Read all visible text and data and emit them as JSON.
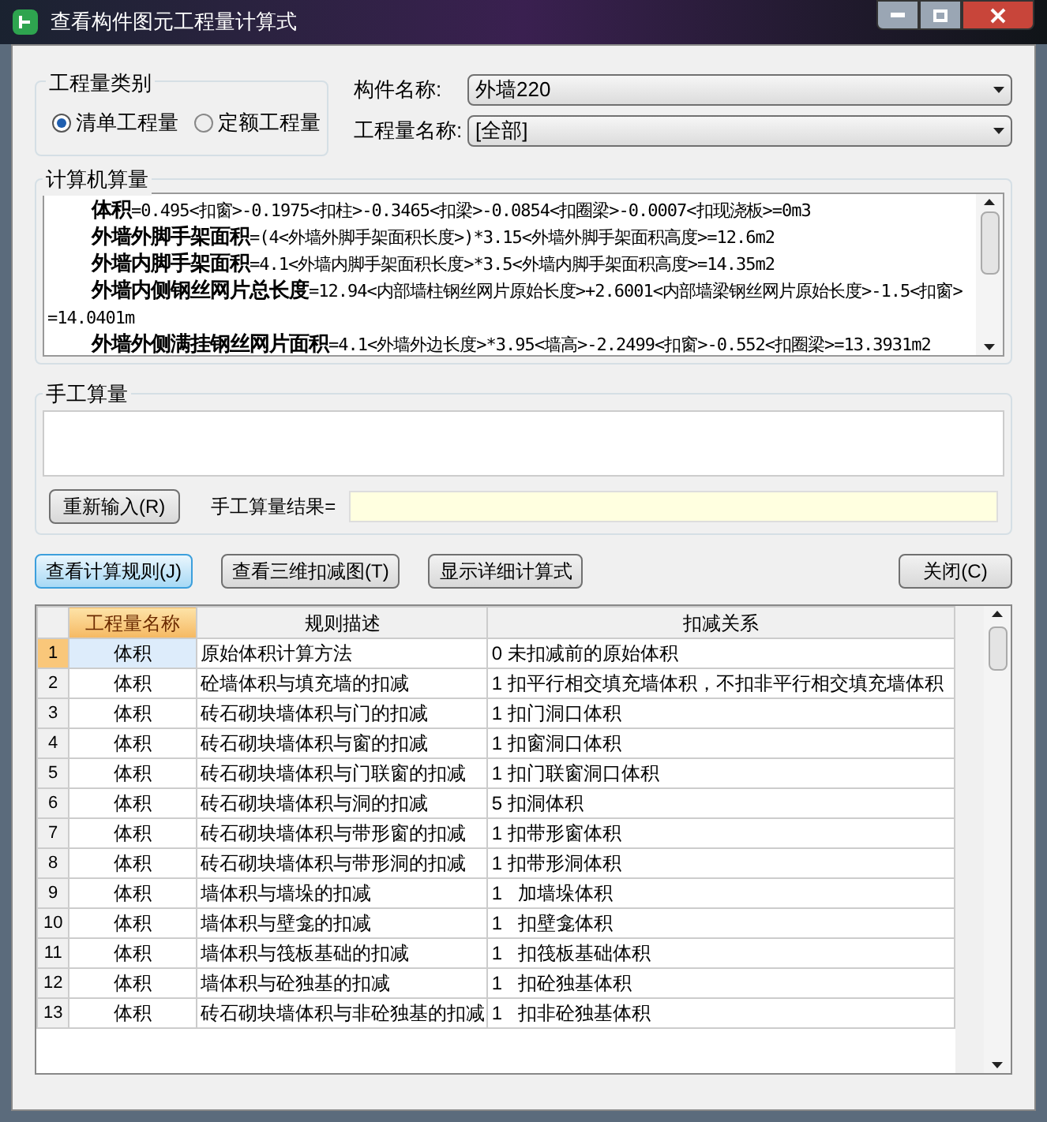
{
  "window": {
    "title": "查看构件图元工程量计算式"
  },
  "quantity_type": {
    "label": "工程量类别",
    "options": [
      {
        "label": "清单工程量",
        "selected": true
      },
      {
        "label": "定额工程量",
        "selected": false
      }
    ]
  },
  "fields": [
    {
      "label": "构件名称:",
      "value": "外墙220"
    },
    {
      "label": "工程量名称:",
      "value": "[全部]"
    }
  ],
  "computer": {
    "label": "计算机算量",
    "lines": [
      "**体积**=0.495<扣窗>-0.1975<扣柱>-0.3465<扣梁>-0.0854<扣圈梁>-0.0007<扣现浇板>=0m3",
      "**外墙外脚手架面积**=(4<外墙外脚手架面积长度>)*3.15<外墙外脚手架面积高度>=12.6m2",
      "**外墙内脚手架面积**=4.1<外墙内脚手架面积长度>*3.5<外墙内脚手架面积高度>=14.35m2",
      "**外墙内侧钢丝网片总长度**=12.94<内部墙柱钢丝网片原始长度>+2.6001<内部墙梁钢丝网片原始长度>-1.5<扣窗>=14.0401m",
      "**外墙外侧满挂钢丝网片面积**=4.1<外墙外边长度>*3.95<墙高>-2.2499<扣窗>-0.552<扣圈梁>=13.3931m2"
    ]
  },
  "manual": {
    "label": "手工算量",
    "reset_button": "重新输入(R)",
    "result_label": "手工算量结果="
  },
  "buttons": [
    {
      "label": "查看计算规则(J)",
      "selected": true
    },
    {
      "label": "查看三维扣减图(T)",
      "selected": false
    },
    {
      "label": "显示详细计算式",
      "selected": false
    },
    {
      "label": "关闭(C)",
      "selected": false
    }
  ],
  "table": {
    "columns": [
      {
        "label": "工程量名称",
        "selected": true
      },
      {
        "label": "规则描述",
        "selected": false
      },
      {
        "label": "扣减关系",
        "selected": false
      }
    ],
    "rows": [
      {
        "number": "1",
        "name": "体积",
        "rule": "原始体积计算方法",
        "relation": "0 未扣减前的原始体积",
        "selected": true
      },
      {
        "number": "2",
        "name": "体积",
        "rule": "砼墙体积与填充墙的扣减",
        "relation": "1 扣平行相交填充墙体积，不扣非平行相交填充墙体积",
        "selected": false
      },
      {
        "number": "3",
        "name": "体积",
        "rule": "砖石砌块墙体积与门的扣减",
        "relation": "1 扣门洞口体积",
        "selected": false
      },
      {
        "number": "4",
        "name": "体积",
        "rule": "砖石砌块墙体积与窗的扣减",
        "relation": "1 扣窗洞口体积",
        "selected": false
      },
      {
        "number": "5",
        "name": "体积",
        "rule": "砖石砌块墙体积与门联窗的扣减",
        "relation": "1 扣门联窗洞口体积",
        "selected": false
      },
      {
        "number": "6",
        "name": "体积",
        "rule": "砖石砌块墙体积与洞的扣减",
        "relation": "5 扣洞体积",
        "selected": false
      },
      {
        "number": "7",
        "name": "体积",
        "rule": "砖石砌块墙体积与带形窗的扣减",
        "relation": "1 扣带形窗体积",
        "selected": false
      },
      {
        "number": "8",
        "name": "体积",
        "rule": "砖石砌块墙体积与带形洞的扣减",
        "relation": "1 扣带形洞体积",
        "selected": false
      },
      {
        "number": "9",
        "name": "体积",
        "rule": "墙体积与墙垛的扣减",
        "relation": "1   加墙垛体积",
        "selected": false
      },
      {
        "number": "10",
        "name": "体积",
        "rule": "墙体积与壁龛的扣减",
        "relation": "1   扣壁龛体积",
        "selected": false
      },
      {
        "number": "11",
        "name": "体积",
        "rule": "墙体积与筏板基础的扣减",
        "relation": "1   扣筏板基础体积",
        "selected": false
      },
      {
        "number": "12",
        "name": "体积",
        "rule": "墙体积与砼独基的扣减",
        "relation": "1   扣砼独基体积",
        "selected": false
      },
      {
        "number": "13",
        "name": "体积",
        "rule": "砖石砌块墙体积与非砼独基的扣减",
        "relation": "1   扣非砼独基体积",
        "selected": false
      }
    ]
  }
}
